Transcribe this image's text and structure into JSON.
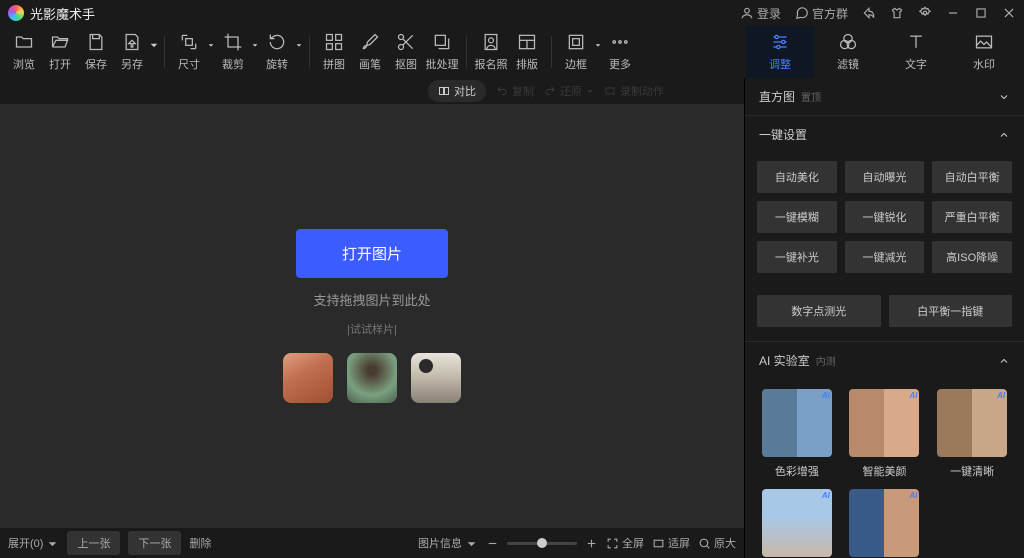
{
  "app": {
    "title": "光影魔术手"
  },
  "title_controls": {
    "login": "登录",
    "group": "官方群"
  },
  "toolbar": {
    "browse": "浏览",
    "open": "打开",
    "save": "保存",
    "saveas": "另存",
    "size": "尺寸",
    "crop": "裁剪",
    "rotate": "旋转",
    "collage": "拼图",
    "brush": "画笔",
    "cutout": "抠图",
    "batch": "批处理",
    "idphoto": "报名照",
    "layout": "排版",
    "border": "边框",
    "more": "更多"
  },
  "right_tabs": {
    "adjust": "调整",
    "filter": "滤镜",
    "text": "文字",
    "watermark": "水印"
  },
  "canvas_bar": {
    "compare": "对比",
    "copy": "复制",
    "paste": "还原",
    "record": "录制动作"
  },
  "center": {
    "open_button": "打开图片",
    "drag_hint": "支持拖拽图片到此处",
    "sample_hint": "|试试样片|"
  },
  "rpanel": {
    "histogram": "直方图",
    "histogram_sub": "置顶",
    "quick_settings": "一键设置",
    "buttons": [
      "自动美化",
      "自动曝光",
      "自动白平衡",
      "一键模糊",
      "一键锐化",
      "严重白平衡",
      "一键补光",
      "一键减光",
      "高ISO降噪"
    ],
    "buttons2": [
      "数字点测光",
      "白平衡一指键"
    ],
    "ai_lab": "AI 实验室",
    "ai_lab_sub": "内测",
    "ai_items": [
      "色彩增强",
      "智能美颜",
      "一键清晰"
    ]
  },
  "bottombar": {
    "expand": "展开(0)",
    "prev": "上一张",
    "next": "下一张",
    "delete": "删除",
    "info": "图片信息",
    "fullscreen": "全屏",
    "fit": "适屏",
    "actual": "原大"
  }
}
